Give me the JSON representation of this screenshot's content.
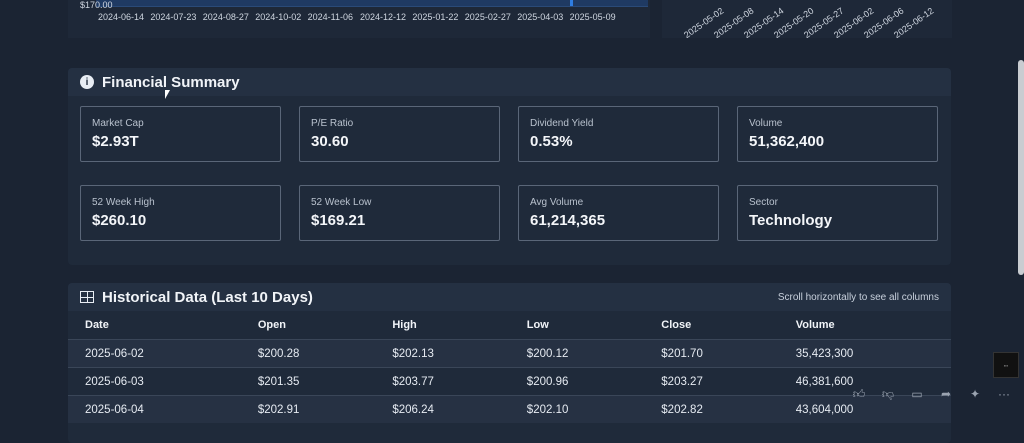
{
  "top_chart": {
    "y_label": "$170.00",
    "x_ticks": [
      "2024-06-14",
      "2024-07-23",
      "2024-08-27",
      "2024-10-02",
      "2024-11-06",
      "2024-12-12",
      "2025-01-22",
      "2025-02-27",
      "2025-04-03",
      "2025-05-09"
    ]
  },
  "right_chart": {
    "x_ticks": [
      "2025-05-02",
      "2025-05-08",
      "2025-05-14",
      "2025-05-20",
      "2025-05-27",
      "2025-06-02",
      "2025-06-06",
      "2025-06-12"
    ]
  },
  "financial_summary": {
    "title": "Financial Summary",
    "cards": [
      {
        "label": "Market Cap",
        "value": "$2.93T"
      },
      {
        "label": "P/E Ratio",
        "value": "30.60"
      },
      {
        "label": "Dividend Yield",
        "value": "0.53%"
      },
      {
        "label": "Volume",
        "value": "51,362,400"
      },
      {
        "label": "52 Week High",
        "value": "$260.10"
      },
      {
        "label": "52 Week Low",
        "value": "$169.21"
      },
      {
        "label": "Avg Volume",
        "value": "61,214,365"
      },
      {
        "label": "Sector",
        "value": "Technology"
      }
    ]
  },
  "historical": {
    "title": "Historical Data (Last 10 Days)",
    "note": "Scroll horizontally to see all columns",
    "columns": [
      "Date",
      "Open",
      "High",
      "Low",
      "Close",
      "Volume"
    ],
    "rows": [
      [
        "2025-06-02",
        "$200.28",
        "$202.13",
        "$200.12",
        "$201.70",
        "35,423,300"
      ],
      [
        "2025-06-03",
        "$201.35",
        "$203.77",
        "$200.96",
        "$203.27",
        "46,381,600"
      ],
      [
        "2025-06-04",
        "$202.91",
        "$206.24",
        "$202.10",
        "$202.82",
        "43,604,000"
      ]
    ]
  },
  "toolbar": {
    "icons": [
      "thumbs-up-icon",
      "thumbs-down-icon",
      "comment-icon",
      "share-icon",
      "sparkle-icon",
      "more-icon"
    ]
  }
}
